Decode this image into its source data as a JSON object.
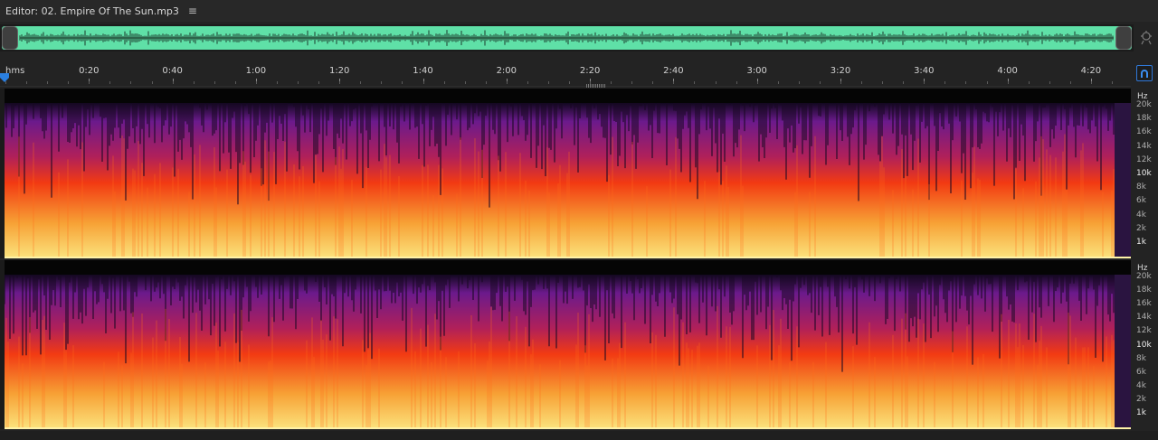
{
  "panel": {
    "title": "Editor: 02. Empire Of The Sun.mp3",
    "menu_icon": "hamburger-menu-icon"
  },
  "overview": {
    "waveform_color": "#5fe0a7",
    "zoom_icon": "zoom-navigator-icon"
  },
  "timeline": {
    "unit": "hms",
    "ticks": [
      "0:20",
      "0:40",
      "1:00",
      "1:20",
      "1:40",
      "2:00",
      "2:20",
      "2:40",
      "3:00",
      "3:20",
      "3:40",
      "4:00",
      "4:20"
    ],
    "snap_icon": "magnet-snap-icon"
  },
  "spectral": {
    "hz_unit": "Hz",
    "hz_labels": [
      "20k",
      "18k",
      "16k",
      "14k",
      "12k",
      "10k",
      "8k",
      "6k",
      "4k",
      "2k",
      "1k"
    ],
    "colors": {
      "low": "#fbe07a",
      "mid": "#f23a12",
      "high": "#6b1a8c",
      "background": "#050505"
    }
  }
}
